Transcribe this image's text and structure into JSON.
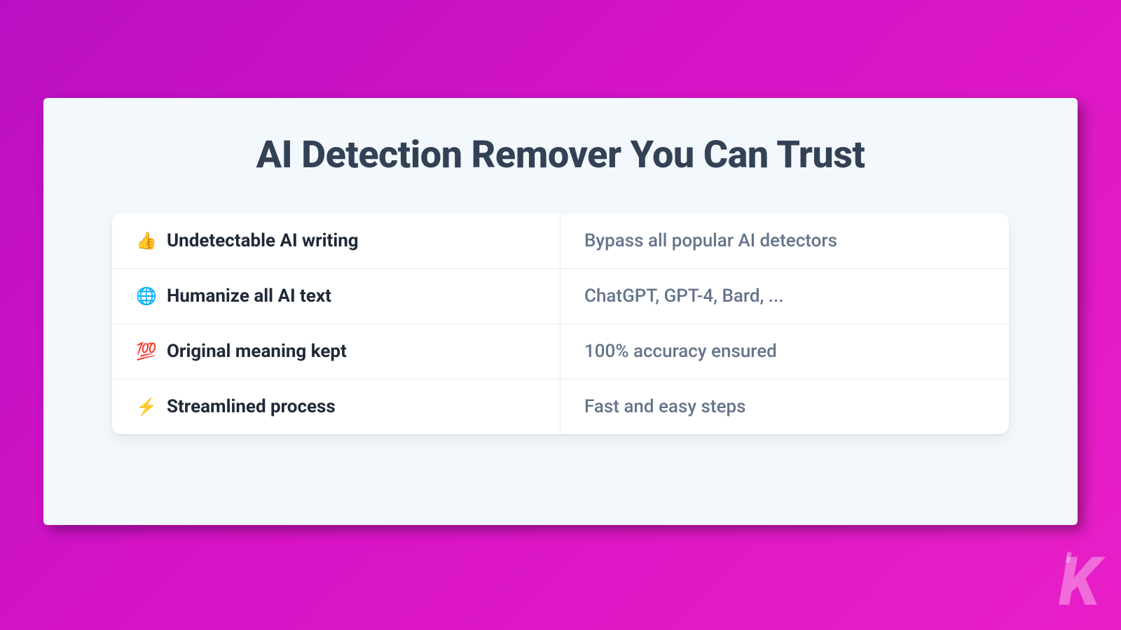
{
  "title": "AI Detection Remover You Can Trust",
  "features": [
    {
      "icon": "👍",
      "icon_name": "thumbs-up-icon",
      "label": "Undetectable AI writing",
      "desc": "Bypass all popular AI detectors"
    },
    {
      "icon": "🌐",
      "icon_name": "globe-icon",
      "label": "Humanize all AI text",
      "desc": "ChatGPT, GPT-4, Bard, ..."
    },
    {
      "icon": "💯",
      "icon_name": "hundred-icon",
      "label": "Original meaning kept",
      "desc": "100% accuracy ensured"
    },
    {
      "icon": "⚡",
      "icon_name": "bolt-icon",
      "label": "Streamlined process",
      "desc": "Fast and easy steps"
    }
  ],
  "watermark": "'K"
}
